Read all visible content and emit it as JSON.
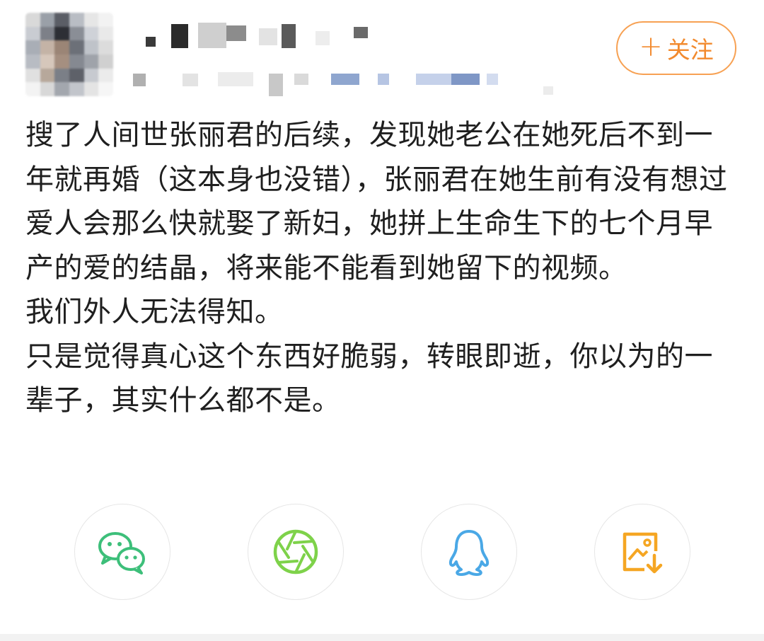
{
  "header": {
    "follow_label": "关注",
    "follow_plus": "+"
  },
  "post": {
    "paragraphs": [
      "搜了人间世张丽君的后续，发现她老公在她死后不到一年就再婚（这本身也没错），张丽君在她生前有没有想过爱人会那么快就娶了新妇，她拼上生命生下的七个月早产的爱的结晶，将来能不能看到她留下的视频。",
      "我们外人无法得知。",
      "只是觉得真心这个东西好脆弱，转眼即逝，你以为的一辈子，其实什么都不是。"
    ]
  },
  "share": {
    "items": [
      {
        "icon": "wechat-icon",
        "color": "#3dbf7a"
      },
      {
        "icon": "moments-icon",
        "color": "#7ed24a"
      },
      {
        "icon": "qq-icon",
        "color": "#4aa8e6"
      },
      {
        "icon": "save-image-icon",
        "color": "#f5a623"
      }
    ]
  },
  "colors": {
    "accent": "#f28a2e",
    "text": "#1f1f1f",
    "border": "#e6e6e6"
  }
}
